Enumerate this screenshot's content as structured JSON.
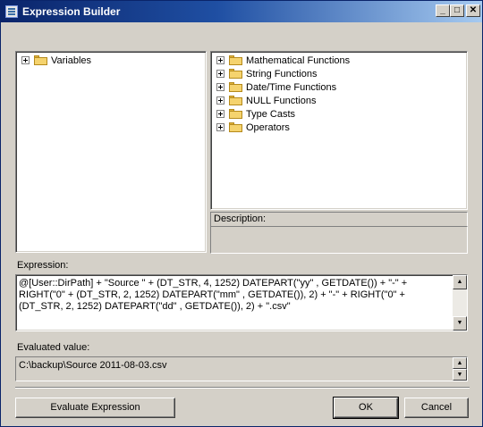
{
  "window": {
    "title": "Expression Builder",
    "controls": {
      "minimize": "_",
      "maximize": "□",
      "close": "✕"
    }
  },
  "variables_tree": {
    "items": [
      {
        "label": "Variables",
        "icon": "folder-icon"
      }
    ]
  },
  "functions_tree": {
    "items": [
      {
        "label": "Mathematical Functions",
        "icon": "folder-icon"
      },
      {
        "label": "String Functions",
        "icon": "folder-icon"
      },
      {
        "label": "Date/Time Functions",
        "icon": "folder-icon"
      },
      {
        "label": "NULL Functions",
        "icon": "folder-icon"
      },
      {
        "label": "Type Casts",
        "icon": "folder-icon"
      },
      {
        "label": "Operators",
        "icon": "folder-icon"
      }
    ]
  },
  "description": {
    "label": "Description:",
    "value": ""
  },
  "expression": {
    "label": "Expression:",
    "value": "@[User::DirPath] + \"Source \" + (DT_STR, 4, 1252)  DATEPART(\"yy\" , GETDATE()) + \"-\" +  RIGHT(\"0\" + (DT_STR, 2, 1252)  DATEPART(\"mm\" , GETDATE()), 2) + \"-\" + RIGHT(\"0\" + (DT_STR, 2, 1252) DATEPART(\"dd\" , GETDATE()), 2) + \".csv\""
  },
  "evaluated": {
    "label": "Evaluated value:",
    "value": "C:\\backup\\Source 2011-08-03.csv"
  },
  "buttons": {
    "evaluate": "Evaluate Expression",
    "ok": "OK",
    "cancel": "Cancel"
  },
  "scroll_glyphs": {
    "up": "▲",
    "down": "▼"
  }
}
